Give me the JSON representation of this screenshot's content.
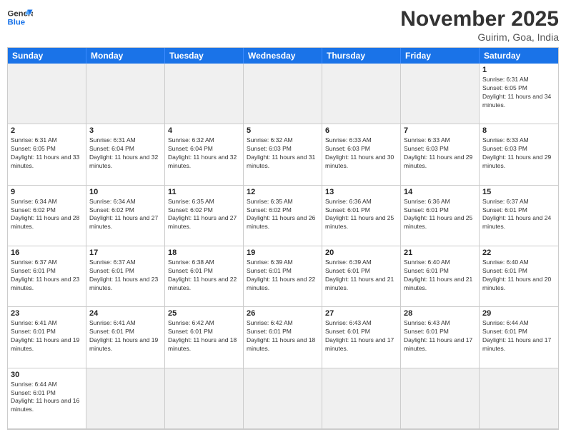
{
  "header": {
    "logo_general": "General",
    "logo_blue": "Blue",
    "month_title": "November 2025",
    "location": "Guirim, Goa, India"
  },
  "day_headers": [
    "Sunday",
    "Monday",
    "Tuesday",
    "Wednesday",
    "Thursday",
    "Friday",
    "Saturday"
  ],
  "cells": [
    {
      "date": "",
      "info": "",
      "empty": true
    },
    {
      "date": "",
      "info": "",
      "empty": true
    },
    {
      "date": "",
      "info": "",
      "empty": true
    },
    {
      "date": "",
      "info": "",
      "empty": true
    },
    {
      "date": "",
      "info": "",
      "empty": true
    },
    {
      "date": "",
      "info": "",
      "empty": true
    },
    {
      "date": "1",
      "info": "Sunrise: 6:31 AM\nSunset: 6:05 PM\nDaylight: 11 hours and 34 minutes.",
      "empty": false
    },
    {
      "date": "2",
      "info": "Sunrise: 6:31 AM\nSunset: 6:05 PM\nDaylight: 11 hours and 33 minutes.",
      "empty": false
    },
    {
      "date": "3",
      "info": "Sunrise: 6:31 AM\nSunset: 6:04 PM\nDaylight: 11 hours and 32 minutes.",
      "empty": false
    },
    {
      "date": "4",
      "info": "Sunrise: 6:32 AM\nSunset: 6:04 PM\nDaylight: 11 hours and 32 minutes.",
      "empty": false
    },
    {
      "date": "5",
      "info": "Sunrise: 6:32 AM\nSunset: 6:03 PM\nDaylight: 11 hours and 31 minutes.",
      "empty": false
    },
    {
      "date": "6",
      "info": "Sunrise: 6:33 AM\nSunset: 6:03 PM\nDaylight: 11 hours and 30 minutes.",
      "empty": false
    },
    {
      "date": "7",
      "info": "Sunrise: 6:33 AM\nSunset: 6:03 PM\nDaylight: 11 hours and 29 minutes.",
      "empty": false
    },
    {
      "date": "8",
      "info": "Sunrise: 6:33 AM\nSunset: 6:03 PM\nDaylight: 11 hours and 29 minutes.",
      "empty": false
    },
    {
      "date": "9",
      "info": "Sunrise: 6:34 AM\nSunset: 6:02 PM\nDaylight: 11 hours and 28 minutes.",
      "empty": false
    },
    {
      "date": "10",
      "info": "Sunrise: 6:34 AM\nSunset: 6:02 PM\nDaylight: 11 hours and 27 minutes.",
      "empty": false
    },
    {
      "date": "11",
      "info": "Sunrise: 6:35 AM\nSunset: 6:02 PM\nDaylight: 11 hours and 27 minutes.",
      "empty": false
    },
    {
      "date": "12",
      "info": "Sunrise: 6:35 AM\nSunset: 6:02 PM\nDaylight: 11 hours and 26 minutes.",
      "empty": false
    },
    {
      "date": "13",
      "info": "Sunrise: 6:36 AM\nSunset: 6:01 PM\nDaylight: 11 hours and 25 minutes.",
      "empty": false
    },
    {
      "date": "14",
      "info": "Sunrise: 6:36 AM\nSunset: 6:01 PM\nDaylight: 11 hours and 25 minutes.",
      "empty": false
    },
    {
      "date": "15",
      "info": "Sunrise: 6:37 AM\nSunset: 6:01 PM\nDaylight: 11 hours and 24 minutes.",
      "empty": false
    },
    {
      "date": "16",
      "info": "Sunrise: 6:37 AM\nSunset: 6:01 PM\nDaylight: 11 hours and 23 minutes.",
      "empty": false
    },
    {
      "date": "17",
      "info": "Sunrise: 6:37 AM\nSunset: 6:01 PM\nDaylight: 11 hours and 23 minutes.",
      "empty": false
    },
    {
      "date": "18",
      "info": "Sunrise: 6:38 AM\nSunset: 6:01 PM\nDaylight: 11 hours and 22 minutes.",
      "empty": false
    },
    {
      "date": "19",
      "info": "Sunrise: 6:39 AM\nSunset: 6:01 PM\nDaylight: 11 hours and 22 minutes.",
      "empty": false
    },
    {
      "date": "20",
      "info": "Sunrise: 6:39 AM\nSunset: 6:01 PM\nDaylight: 11 hours and 21 minutes.",
      "empty": false
    },
    {
      "date": "21",
      "info": "Sunrise: 6:40 AM\nSunset: 6:01 PM\nDaylight: 11 hours and 21 minutes.",
      "empty": false
    },
    {
      "date": "22",
      "info": "Sunrise: 6:40 AM\nSunset: 6:01 PM\nDaylight: 11 hours and 20 minutes.",
      "empty": false
    },
    {
      "date": "23",
      "info": "Sunrise: 6:41 AM\nSunset: 6:01 PM\nDaylight: 11 hours and 19 minutes.",
      "empty": false
    },
    {
      "date": "24",
      "info": "Sunrise: 6:41 AM\nSunset: 6:01 PM\nDaylight: 11 hours and 19 minutes.",
      "empty": false
    },
    {
      "date": "25",
      "info": "Sunrise: 6:42 AM\nSunset: 6:01 PM\nDaylight: 11 hours and 18 minutes.",
      "empty": false
    },
    {
      "date": "26",
      "info": "Sunrise: 6:42 AM\nSunset: 6:01 PM\nDaylight: 11 hours and 18 minutes.",
      "empty": false
    },
    {
      "date": "27",
      "info": "Sunrise: 6:43 AM\nSunset: 6:01 PM\nDaylight: 11 hours and 17 minutes.",
      "empty": false
    },
    {
      "date": "28",
      "info": "Sunrise: 6:43 AM\nSunset: 6:01 PM\nDaylight: 11 hours and 17 minutes.",
      "empty": false
    },
    {
      "date": "29",
      "info": "Sunrise: 6:44 AM\nSunset: 6:01 PM\nDaylight: 11 hours and 17 minutes.",
      "empty": false
    },
    {
      "date": "30",
      "info": "Sunrise: 6:44 AM\nSunset: 6:01 PM\nDaylight: 11 hours and 16 minutes.",
      "empty": false
    },
    {
      "date": "",
      "info": "",
      "empty": true
    },
    {
      "date": "",
      "info": "",
      "empty": true
    },
    {
      "date": "",
      "info": "",
      "empty": true
    },
    {
      "date": "",
      "info": "",
      "empty": true
    },
    {
      "date": "",
      "info": "",
      "empty": true
    },
    {
      "date": "",
      "info": "",
      "empty": true
    }
  ]
}
